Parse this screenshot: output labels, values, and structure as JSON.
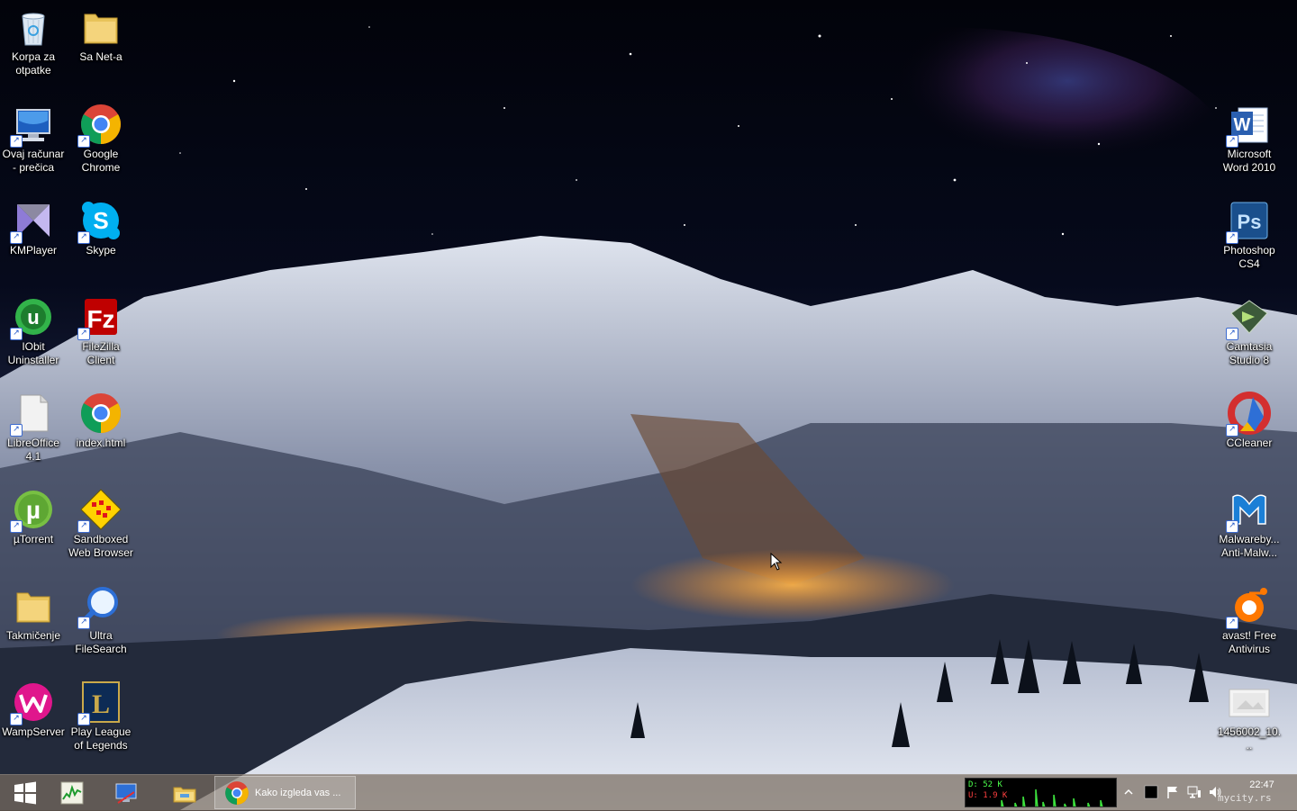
{
  "desktop": {
    "icons": [
      {
        "label": "Korpa za otpatke",
        "icon": "recycle-bin-icon",
        "shortcut": false
      },
      {
        "label": "Sa Net-a",
        "icon": "folder-icon",
        "shortcut": false
      },
      {
        "label": "Ovaj računar - prečica",
        "icon": "computer-icon",
        "shortcut": true
      },
      {
        "label": "Google Chrome",
        "icon": "chrome-icon",
        "shortcut": true
      },
      {
        "label": "KMPlayer",
        "icon": "kmplayer-icon",
        "shortcut": true
      },
      {
        "label": "Skype",
        "icon": "skype-icon",
        "shortcut": true
      },
      {
        "label": "IObit Uninstaller",
        "icon": "iobit-uninstaller-icon",
        "shortcut": true
      },
      {
        "label": "FileZilla Client",
        "icon": "filezilla-icon",
        "shortcut": true
      },
      {
        "label": "LibreOffice 4.1",
        "icon": "libreoffice-icon",
        "shortcut": true
      },
      {
        "label": "index.html",
        "icon": "chrome-icon",
        "shortcut": false
      },
      {
        "label": "µTorrent",
        "icon": "utorrent-icon",
        "shortcut": true
      },
      {
        "label": "Sandboxed Web Browser",
        "icon": "sandboxed-browser-icon",
        "shortcut": true
      },
      {
        "label": "Takmičenje",
        "icon": "folder-icon",
        "shortcut": false
      },
      {
        "label": "Ultra FileSearch",
        "icon": "search-icon",
        "shortcut": true
      },
      {
        "label": "WampServer",
        "icon": "wampserver-icon",
        "shortcut": true
      },
      {
        "label": "Play League of Legends",
        "icon": "league-of-legends-icon",
        "shortcut": true
      },
      {
        "label": "Microsoft Word 2010",
        "icon": "word-icon",
        "shortcut": true
      },
      {
        "label": "Photoshop CS4",
        "icon": "photoshop-icon",
        "shortcut": true
      },
      {
        "label": "Camtasia Studio 8",
        "icon": "camtasia-icon",
        "shortcut": true
      },
      {
        "label": "CCleaner",
        "icon": "ccleaner-icon",
        "shortcut": true
      },
      {
        "label": "Malwareby... Anti-Malw...",
        "icon": "malwarebytes-icon",
        "shortcut": true
      },
      {
        "label": "avast! Free Antivirus",
        "icon": "avast-icon",
        "shortcut": true
      },
      {
        "label": "1456002_10...",
        "icon": "image-file-icon",
        "shortcut": false
      }
    ]
  },
  "taskbar": {
    "start_icon": "windows-start-icon",
    "pinned": [
      {
        "name": "task-manager-icon"
      },
      {
        "name": "remote-desktop-icon"
      },
      {
        "name": "file-explorer-icon"
      }
    ],
    "active_task": {
      "label": "Kako izgleda vas ...",
      "icon": "chrome-icon"
    },
    "netmeter": {
      "download": "D: 52 K",
      "upload": "U: 1.9 K"
    },
    "tray": [
      "show-hidden-icons-icon",
      "stop-icon",
      "action-center-flag-icon",
      "network-icon",
      "volume-icon"
    ],
    "clock": {
      "time": "22:47"
    },
    "watermark": "mycity.rs"
  },
  "colors": {
    "taskbar": "#786c60",
    "label_text": "#ffffff",
    "netmeter_down": "#4cff4c",
    "netmeter_up": "#ff4040"
  }
}
